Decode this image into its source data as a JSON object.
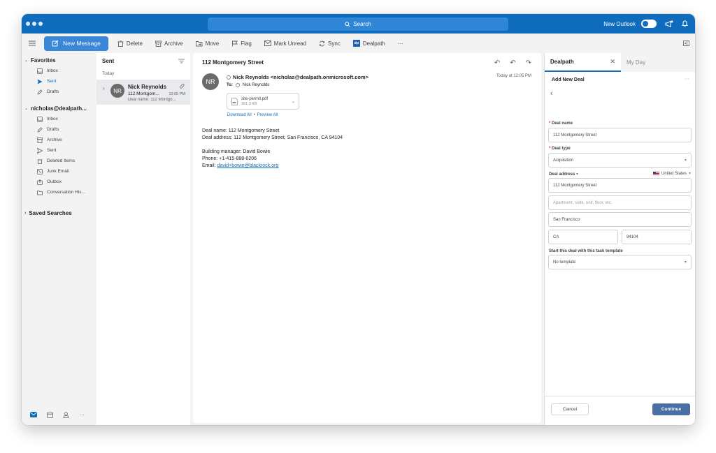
{
  "titlebar": {
    "search_label": "Search",
    "new_outlook_label": "New Outlook"
  },
  "toolbar": {
    "new_message": "New Message",
    "delete": "Delete",
    "archive": "Archive",
    "move": "Move",
    "flag": "Flag",
    "mark_unread": "Mark Unread",
    "sync": "Sync",
    "dealpath": "Dealpath",
    "dealpath_badge": "dp",
    "more": "···"
  },
  "folders": {
    "favorites_label": "Favorites",
    "favorites": [
      "Inbox",
      "Sent",
      "Drafts"
    ],
    "account_label": "nicholas@dealpath...",
    "account_folders": [
      "Inbox",
      "Drafts",
      "Archive",
      "Sent",
      "Deleted Items",
      "Junk Email",
      "Outbox",
      "Conversation His..."
    ],
    "saved_searches_label": "Saved Searches"
  },
  "message_list": {
    "folder_title": "Sent",
    "group_label": "Today",
    "item": {
      "initials": "NR",
      "sender": "Nick Reynolds",
      "subject": "112 Montgom...",
      "time": "12:05 PM",
      "preview": "Deal name: 112 Montgo..."
    }
  },
  "reading": {
    "subject": "112 Montgomery Street",
    "initials": "NR",
    "from": "Nick Reynolds <nicholas@dealpath.onmicrosoft.com>",
    "to_label": "To:",
    "to_name": "Nick Reynolds",
    "timestamp": "Today at 12:05 PM",
    "attachment": {
      "name": "site-permit.pdf",
      "size": "181.3 KB"
    },
    "download_all": "Download All",
    "separator": "•",
    "preview_all": "Preview All",
    "body": {
      "line1": "Deal name: 112 Montgomery Street",
      "line2": "Deal address: 112 Montgomery Street, San Francisco, CA 94104",
      "line3": "Building manager: David Bowie",
      "line4": "Phone: +1-415-888-0206",
      "email_label": "Email:",
      "email": "david+bowie@blackrock.org"
    }
  },
  "dealpath_pane": {
    "tab_active": "Dealpath",
    "tab_other": "My Day",
    "header": "Add New Deal",
    "more": "···",
    "deal_name_label": "Deal name",
    "deal_name_value": "112 Montgomery Street",
    "deal_type_label": "Deal type",
    "deal_type_value": "Acquisition",
    "deal_address_label": "Deal address",
    "country": "United States",
    "address_line1": "112 Montgomery Street",
    "address_line2_placeholder": "Apartment, suite, unit, floor, etc.",
    "city": "San Francisco",
    "state": "CA",
    "zip": "94104",
    "template_label": "Start this deal with this task template",
    "template_value": "No template",
    "cancel": "Cancel",
    "continue": "Continue"
  },
  "colors": {
    "brand_blue": "#0f6cbd",
    "new_message_blue": "#3a86d7",
    "continue_blue": "#4a6fa5",
    "required_red": "#d13438"
  }
}
